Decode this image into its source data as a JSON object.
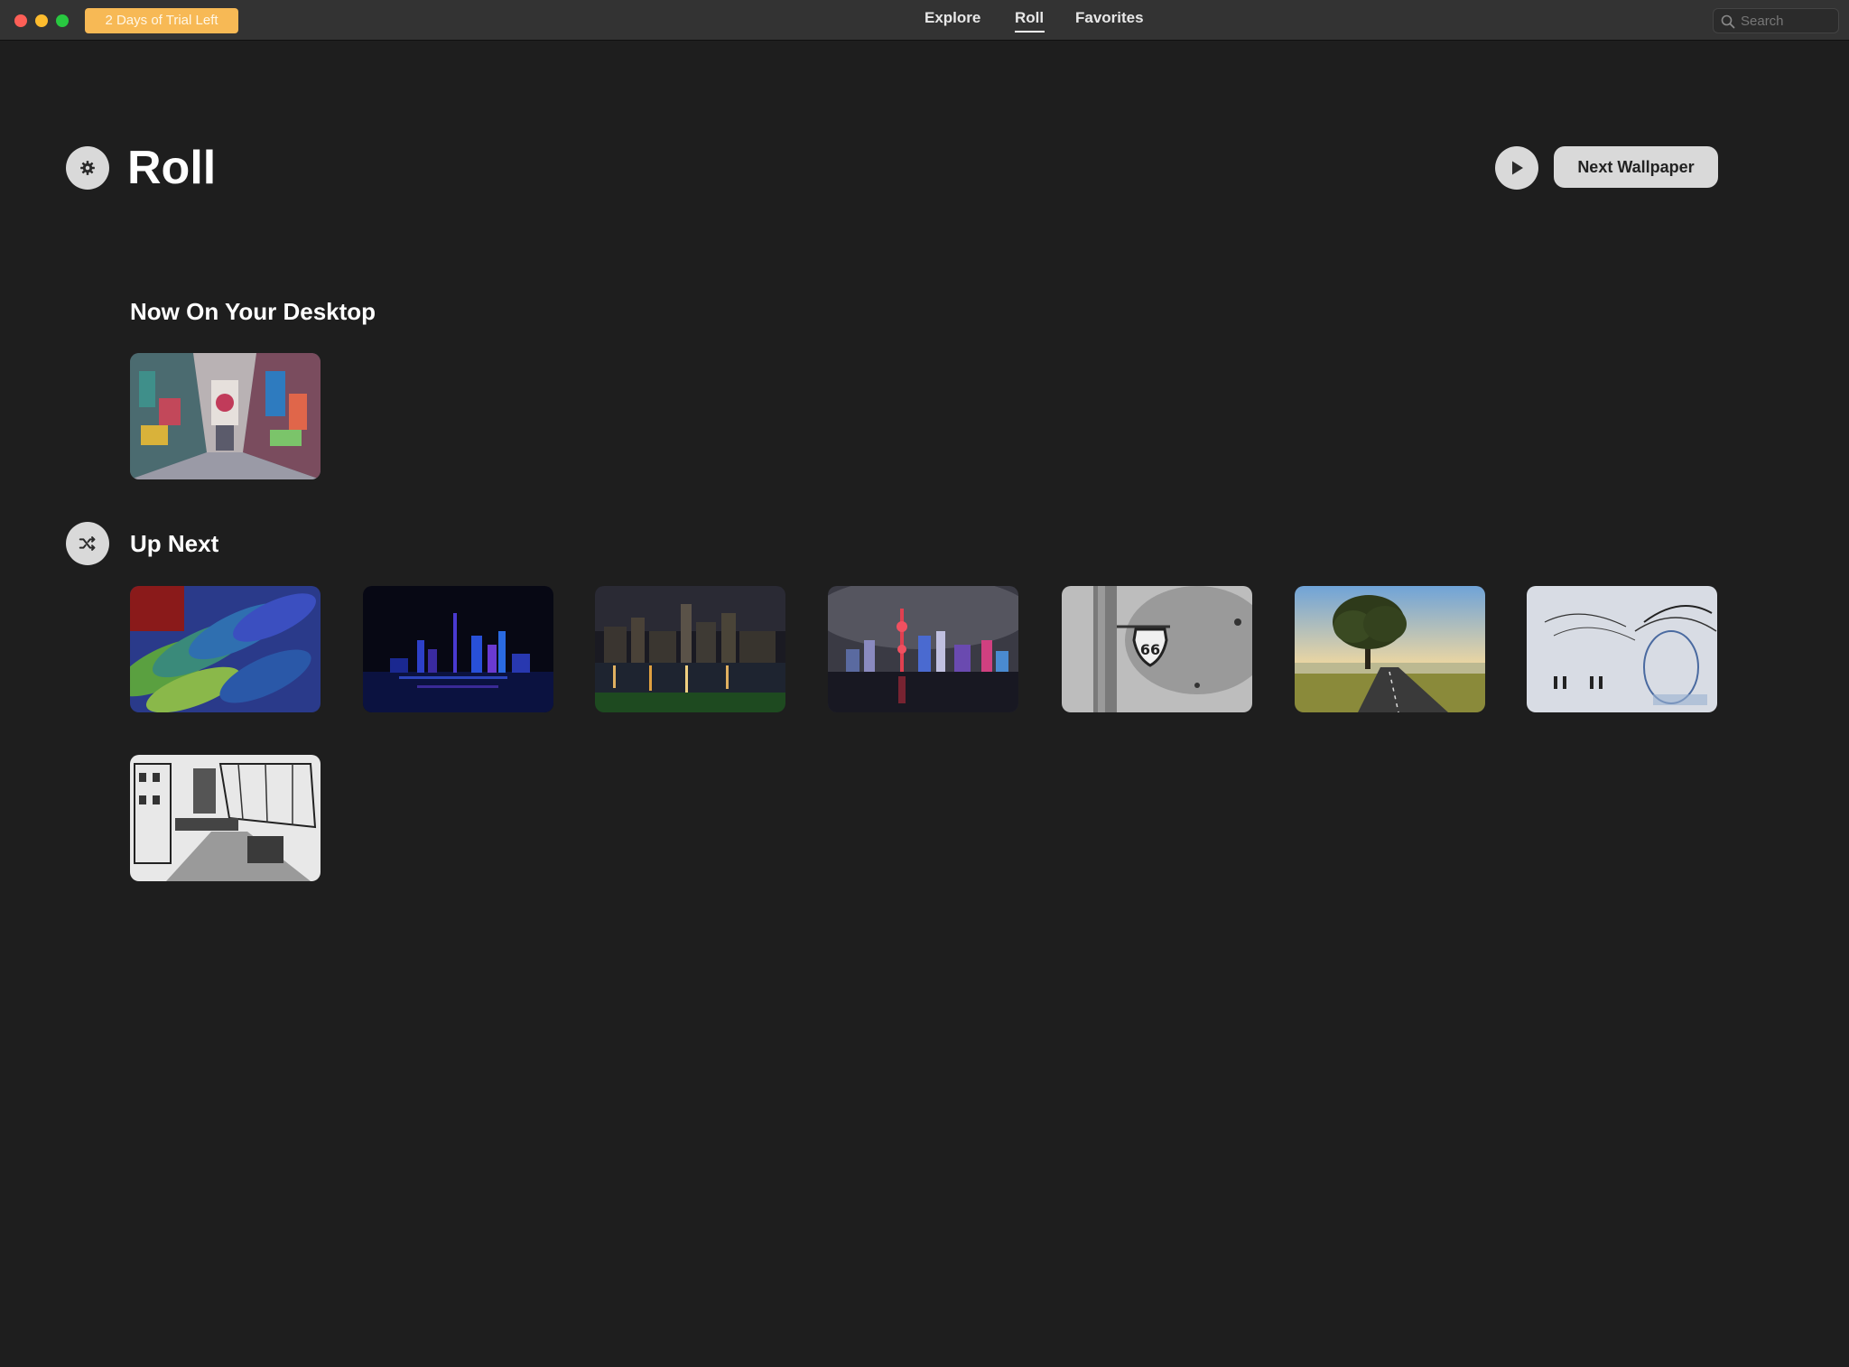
{
  "titlebar": {
    "trial_badge": "2 Days of Trial Left",
    "tabs": [
      {
        "label": "Explore",
        "active": false
      },
      {
        "label": "Roll",
        "active": true
      },
      {
        "label": "Favorites",
        "active": false
      }
    ],
    "search_placeholder": "Search",
    "search_value": ""
  },
  "header": {
    "title": "Roll",
    "next_button": "Next Wallpaper",
    "settings_icon": "gear-icon",
    "play_icon": "play-icon"
  },
  "now_section": {
    "title": "Now On Your Desktop",
    "wallpaper": "graffiti alley"
  },
  "upnext_section": {
    "title": "Up Next",
    "shuffle_icon": "shuffle-icon",
    "wallpapers": [
      "parrot feathers",
      "night city skyline blue",
      "city skyline reflection",
      "shanghai skyline night",
      "route 66 sign",
      "tree by country road",
      "sketch mural on wall",
      "ink sketch street scene"
    ]
  },
  "colors": {
    "background": "#1e1e1e",
    "titlebar": "#333333",
    "badge": "#f7b955",
    "button": "#d9d9d9"
  }
}
